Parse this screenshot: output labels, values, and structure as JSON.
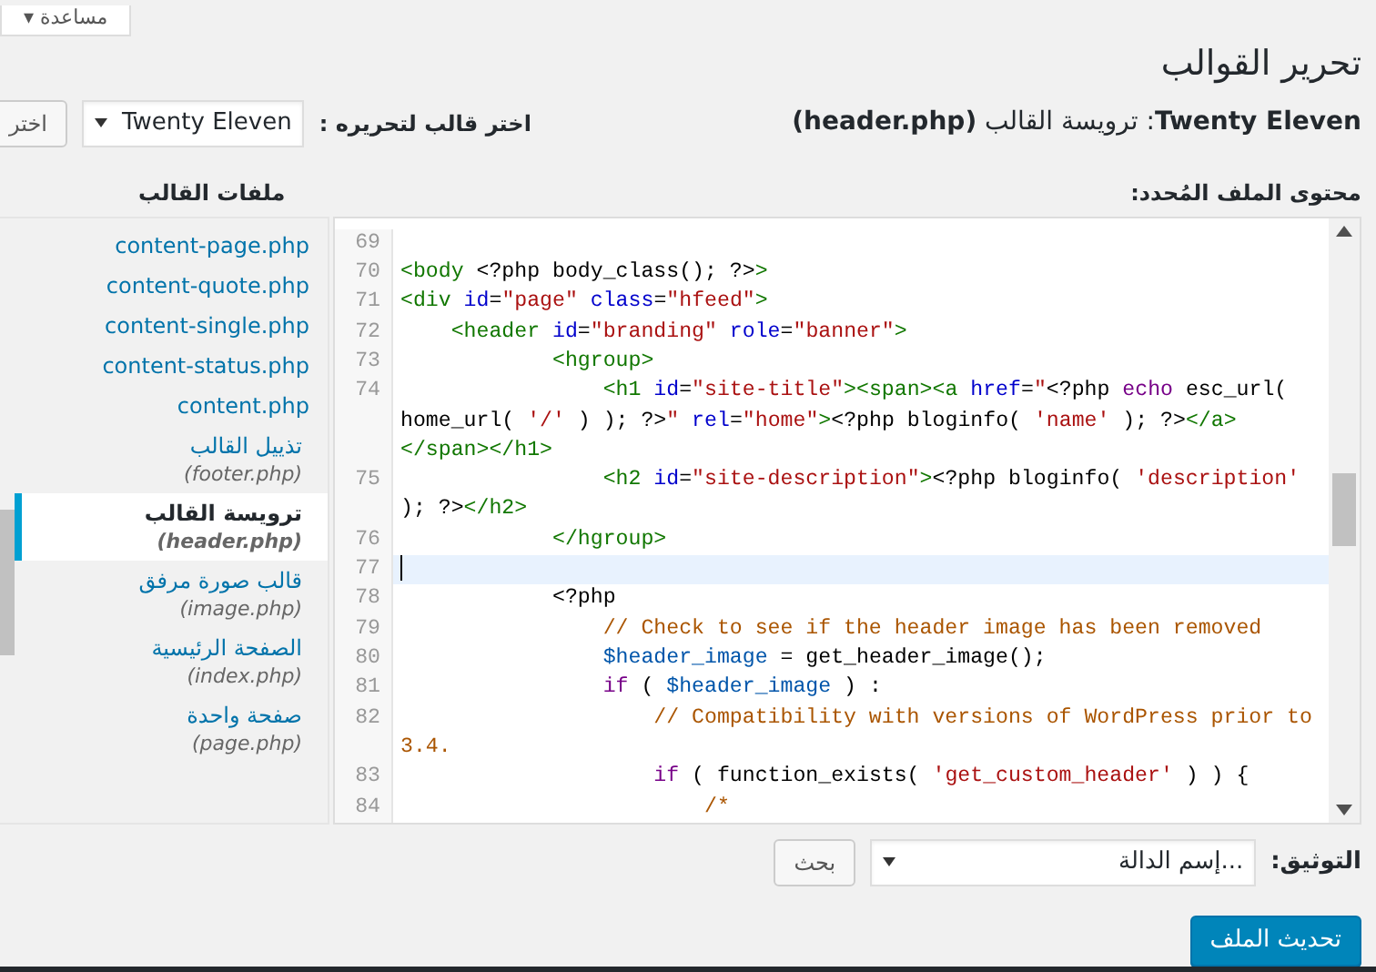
{
  "help_button": {
    "label": "مساعدة ▾"
  },
  "page_title": "تحرير القوالب",
  "file_heading": "**Twenty Eleven**: ترويسة القالب **(header.php)**",
  "theme_picker": {
    "label": "اختر قالب لتحريره :",
    "value": "Twenty Eleven",
    "button": "اختر"
  },
  "editor_label": "محتوى الملف المُحدد:",
  "sidebar": {
    "title": "ملفات القالب",
    "items": [
      {
        "label": "content-page.php",
        "selected": false
      },
      {
        "label": "content-quote.php",
        "selected": false
      },
      {
        "label": "content-single.php",
        "selected": false
      },
      {
        "label": "content-status.php",
        "selected": false
      },
      {
        "label": "content.php",
        "selected": false
      },
      {
        "label": "تذييل القالب",
        "file": "(footer.php)",
        "selected": false
      },
      {
        "label": "ترويسة القالب",
        "file": "(header.php)",
        "selected": true
      },
      {
        "label": "قالب صورة مرفق",
        "file": "(image.php)",
        "selected": false
      },
      {
        "label": "الصفحة الرئيسية",
        "file": "(index.php)",
        "selected": false
      },
      {
        "label": "صفحة واحدة",
        "file": "(page.php)",
        "selected": false
      }
    ]
  },
  "code_lines": [
    {
      "number": "69",
      "cursor": false
    },
    {
      "number": "70",
      "cursor": false,
      "segments": [
        {
          "kind": "tag",
          "text": "<body"
        },
        {
          "kind": "txt",
          "text": " <?php body_class(); ?>"
        },
        {
          "kind": "tag",
          "text": ">"
        }
      ]
    },
    {
      "number": "71",
      "cursor": false,
      "segments": [
        {
          "kind": "tag",
          "text": "<div"
        },
        {
          "kind": "attr",
          "text": " id"
        },
        {
          "kind": "txt",
          "text": "="
        },
        {
          "kind": "str",
          "text": "\"page\""
        },
        {
          "kind": "attr",
          "text": " class"
        },
        {
          "kind": "txt",
          "text": "="
        },
        {
          "kind": "str",
          "text": "\"hfeed\""
        },
        {
          "kind": "tag",
          "text": ">"
        }
      ]
    },
    {
      "number": "72",
      "cursor": false,
      "segments": [
        {
          "kind": "tag",
          "text": "    <header"
        },
        {
          "kind": "attr",
          "text": " id"
        },
        {
          "kind": "txt",
          "text": "="
        },
        {
          "kind": "str",
          "text": "\"branding\""
        },
        {
          "kind": "attr",
          "text": " role"
        },
        {
          "kind": "txt",
          "text": "="
        },
        {
          "kind": "str",
          "text": "\"banner\""
        },
        {
          "kind": "tag",
          "text": ">"
        }
      ]
    },
    {
      "number": "73",
      "cursor": false,
      "segments": [
        {
          "kind": "tag",
          "text": "            <hgroup>"
        }
      ]
    },
    {
      "number": "74",
      "cursor": false,
      "segments": [
        {
          "kind": "tag",
          "text": "                <h1"
        },
        {
          "kind": "attr",
          "text": " id"
        },
        {
          "kind": "txt",
          "text": "="
        },
        {
          "kind": "str",
          "text": "\"site-title\""
        },
        {
          "kind": "tag",
          "text": "><span><a"
        },
        {
          "kind": "attr",
          "text": " href"
        },
        {
          "kind": "txt",
          "text": "="
        },
        {
          "kind": "str",
          "text": "\""
        },
        {
          "kind": "txt",
          "text": "<?php "
        },
        {
          "kind": "kw",
          "text": "echo"
        },
        {
          "kind": "txt",
          "text": " esc_url( home_url( "
        },
        {
          "kind": "str",
          "text": "'/'"
        },
        {
          "kind": "txt",
          "text": " ) ); ?>"
        },
        {
          "kind": "str",
          "text": "\""
        },
        {
          "kind": "attr",
          "text": " rel"
        },
        {
          "kind": "txt",
          "text": "="
        },
        {
          "kind": "str",
          "text": "\"home\""
        },
        {
          "kind": "tag",
          "text": ">"
        },
        {
          "kind": "txt",
          "text": "<?php bloginfo( "
        },
        {
          "kind": "str",
          "text": "'name'"
        },
        {
          "kind": "txt",
          "text": " ); ?>"
        },
        {
          "kind": "tag",
          "text": "</a> </span></h1>"
        }
      ]
    },
    {
      "number": "75",
      "cursor": false,
      "segments": [
        {
          "kind": "tag",
          "text": "                <h2"
        },
        {
          "kind": "attr",
          "text": " id"
        },
        {
          "kind": "txt",
          "text": "="
        },
        {
          "kind": "str",
          "text": "\"site-description\""
        },
        {
          "kind": "tag",
          "text": ">"
        },
        {
          "kind": "txt",
          "text": "<?php bloginfo( "
        },
        {
          "kind": "str",
          "text": "'description'"
        },
        {
          "kind": "txt",
          "text": " ); ?>"
        },
        {
          "kind": "tag",
          "text": "</h2>"
        }
      ]
    },
    {
      "number": "76",
      "cursor": false,
      "segments": [
        {
          "kind": "tag",
          "text": "            </hgroup>"
        }
      ]
    },
    {
      "number": "77",
      "cursor": true
    },
    {
      "number": "78",
      "cursor": false,
      "segments": [
        {
          "kind": "txt",
          "text": "            <?php"
        }
      ]
    },
    {
      "number": "79",
      "cursor": false,
      "segments": [
        {
          "kind": "com",
          "text": "                // Check to see if the header image has been removed"
        }
      ]
    },
    {
      "number": "80",
      "cursor": false,
      "segments": [
        {
          "kind": "var",
          "text": "                $header_image"
        },
        {
          "kind": "txt",
          "text": " = get_header_image();"
        }
      ]
    },
    {
      "number": "81",
      "cursor": false,
      "segments": [
        {
          "kind": "kw",
          "text": "                if"
        },
        {
          "kind": "txt",
          "text": " ( "
        },
        {
          "kind": "var",
          "text": "$header_image"
        },
        {
          "kind": "txt",
          "text": " ) :"
        }
      ]
    },
    {
      "number": "82",
      "cursor": false,
      "segments": [
        {
          "kind": "com",
          "text": "                    // Compatibility with versions of WordPress prior to 3.4."
        }
      ]
    },
    {
      "number": "83",
      "cursor": false,
      "segments": [
        {
          "kind": "kw",
          "text": "                    if"
        },
        {
          "kind": "txt",
          "text": " ( function_exists( "
        },
        {
          "kind": "str",
          "text": "'get_custom_header'"
        },
        {
          "kind": "txt",
          "text": " ) ) {"
        }
      ]
    },
    {
      "number": "84",
      "cursor": false,
      "segments": [
        {
          "kind": "com",
          "text": "                        /*"
        }
      ]
    }
  ],
  "documentation": {
    "label": "التوثيق:",
    "value": "...إسم الدالة",
    "button": "بحث"
  },
  "update_button": "تحديث الملف"
}
